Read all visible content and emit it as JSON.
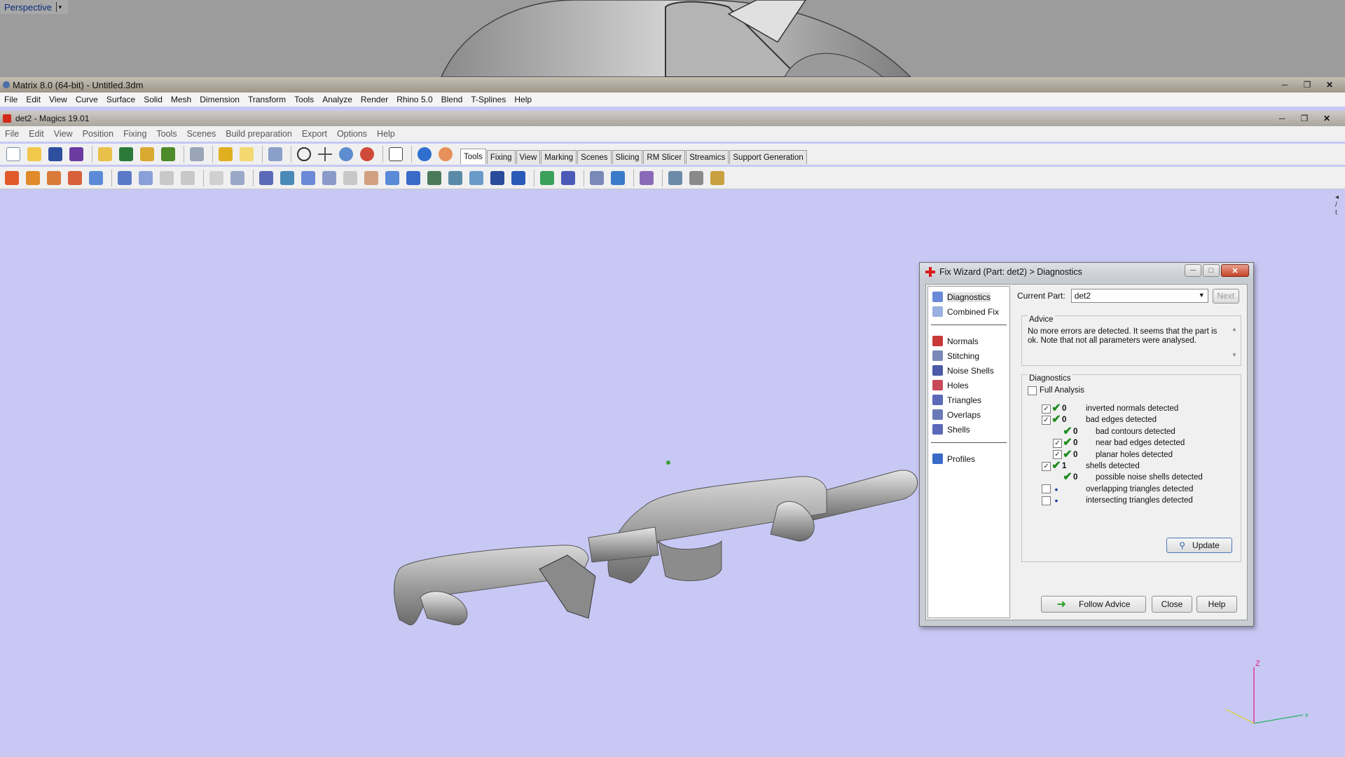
{
  "rhino": {
    "viewport_label": "Perspective",
    "title": "Matrix 8.0 (64-bit) - Untitled.3dm",
    "menu": [
      "File",
      "Edit",
      "View",
      "Curve",
      "Surface",
      "Solid",
      "Mesh",
      "Dimension",
      "Transform",
      "Tools",
      "Analyze",
      "Render",
      "Rhino 5.0",
      "Blend",
      "T-Splines",
      "Help"
    ]
  },
  "magics": {
    "title": "det2 - Magics 19.01",
    "menu": [
      "File",
      "Edit",
      "View",
      "Position",
      "Fixing",
      "Tools",
      "Scenes",
      "Build preparation",
      "Export",
      "Options",
      "Help"
    ],
    "tabs": [
      "Tools",
      "Fixing",
      "View",
      "Marking",
      "Scenes",
      "Slicing",
      "RM Slicer",
      "Streamics",
      "Support Generation"
    ],
    "active_tab": "Tools"
  },
  "viewport": {
    "background": "#c8c8f4",
    "axis_z_label": "Z"
  },
  "fix_wizard": {
    "title": "Fix Wizard (Part: det2) > Diagnostics",
    "nav_top": [
      {
        "label": "Diagnostics",
        "icon": "magnifier-icon"
      },
      {
        "label": "Combined Fix",
        "icon": "combined-fix-icon"
      }
    ],
    "nav_tools": [
      {
        "label": "Normals",
        "icon": "normals-icon"
      },
      {
        "label": "Stitching",
        "icon": "stitching-icon"
      },
      {
        "label": "Noise Shells",
        "icon": "noise-shells-icon"
      },
      {
        "label": "Holes",
        "icon": "holes-icon"
      },
      {
        "label": "Triangles",
        "icon": "triangles-icon"
      },
      {
        "label": "Overlaps",
        "icon": "overlaps-icon"
      },
      {
        "label": "Shells",
        "icon": "shells-icon"
      }
    ],
    "nav_bottom": [
      {
        "label": "Profiles",
        "icon": "profiles-icon"
      }
    ],
    "current_part_label": "Current Part:",
    "current_part_value": "det2",
    "next_label": "Next",
    "advice_title": "Advice",
    "advice_text": "No more errors are detected. It seems that the part is ok. Note that not all parameters were analysed.",
    "diagnostics_title": "Diagnostics",
    "full_analysis_label": "Full Analysis",
    "full_analysis_checked": false,
    "rows": [
      {
        "checkbox": true,
        "checked": true,
        "status": "ok",
        "count": "0",
        "text": "inverted normals detected",
        "indent": 0
      },
      {
        "checkbox": true,
        "checked": true,
        "status": "ok",
        "count": "0",
        "text": "bad edges detected",
        "indent": 0
      },
      {
        "checkbox": false,
        "checked": false,
        "status": "ok",
        "count": "0",
        "text": "bad contours detected",
        "indent": 1
      },
      {
        "checkbox": true,
        "checked": true,
        "status": "ok",
        "count": "0",
        "text": "near bad edges detected",
        "indent": 1
      },
      {
        "checkbox": true,
        "checked": true,
        "status": "ok",
        "count": "0",
        "text": "planar holes detected",
        "indent": 1
      },
      {
        "checkbox": true,
        "checked": true,
        "status": "ok",
        "count": "1",
        "text": "shells detected",
        "indent": 0
      },
      {
        "checkbox": false,
        "checked": false,
        "status": "ok",
        "count": "0",
        "text": "possible noise shells detected",
        "indent": 1
      },
      {
        "checkbox": true,
        "checked": false,
        "status": "pending",
        "count": "",
        "text": "overlapping triangles detected",
        "indent": 0
      },
      {
        "checkbox": true,
        "checked": false,
        "status": "pending",
        "count": "",
        "text": "intersecting triangles detected",
        "indent": 0
      }
    ],
    "update_label": "Update",
    "follow_advice_label": "Follow Advice",
    "close_label": "Close",
    "help_label": "Help"
  }
}
